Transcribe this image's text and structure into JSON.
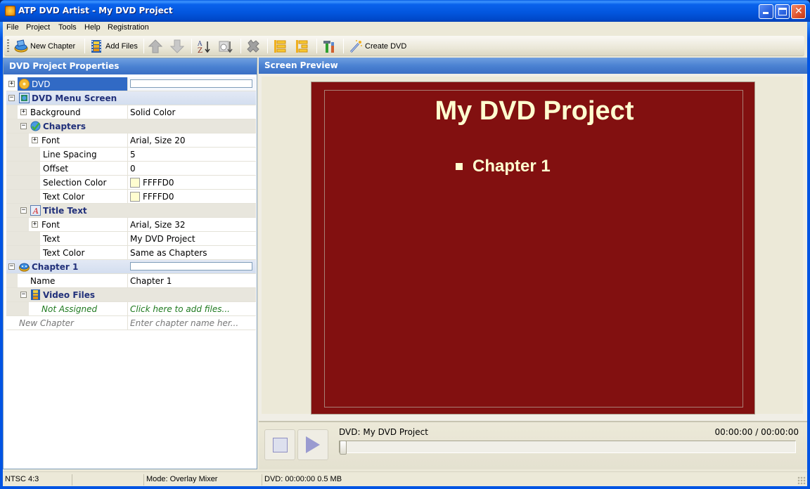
{
  "window": {
    "title": "ATP DVD Artist - My DVD Project",
    "minimize_glyph": "_",
    "maximize_glyph": "□",
    "close_glyph": "✕"
  },
  "menubar": [
    "File",
    "Project",
    "Tools",
    "Help",
    "Registration"
  ],
  "toolbar": {
    "new_chapter": "New Chapter",
    "add_files": "Add Files",
    "create_dvd": "Create DVD"
  },
  "left_panel": {
    "title": "DVD Project Properties",
    "rows": [
      {
        "name": "DVD",
        "value": "",
        "kind": "root-selected"
      },
      {
        "name": "DVD Menu Screen",
        "value": "",
        "kind": "category"
      },
      {
        "name": "Background",
        "value": "Solid Color"
      },
      {
        "name": "Chapters",
        "value": "",
        "kind": "subcategory"
      },
      {
        "name": "Font",
        "value": "Arial, Size 20"
      },
      {
        "name": "Line Spacing",
        "value": "5"
      },
      {
        "name": "Offset",
        "value": "0"
      },
      {
        "name": "Selection Color",
        "value": "FFFFD0",
        "swatch": "#FFFFD0"
      },
      {
        "name": "Text Color",
        "value": "FFFFD0",
        "swatch": "#FFFFD0"
      },
      {
        "name": "Title Text",
        "value": "",
        "kind": "subcategory"
      },
      {
        "name": "Font",
        "value": "Arial, Size 32"
      },
      {
        "name": "Text",
        "value": "My DVD Project"
      },
      {
        "name": "Text Color",
        "value": "Same as Chapters"
      },
      {
        "name": "Chapter 1",
        "value": "",
        "kind": "category"
      },
      {
        "name": "Name",
        "value": "Chapter 1"
      },
      {
        "name": "Video Files",
        "value": "",
        "kind": "subcategory"
      },
      {
        "name": "Not Assigned",
        "value": "Click here to add files..."
      },
      {
        "name": "New Chapter",
        "value": "Enter chapter name her..."
      }
    ]
  },
  "right_panel": {
    "title": "Screen Preview",
    "preview": {
      "title": "My DVD Project",
      "chapters": [
        "Chapter 1"
      ],
      "background_color": "#821010",
      "text_color": "#FFFFD0"
    },
    "player": {
      "label": "DVD: My DVD Project",
      "time": "00:00:00 / 00:00:00",
      "progress": 0
    }
  },
  "statusbar": {
    "format": "NTSC   4:3",
    "empty": "",
    "mode": "Mode: Overlay Mixer",
    "dvd_info": "DVD:   00:00:00  0.5 MB"
  }
}
